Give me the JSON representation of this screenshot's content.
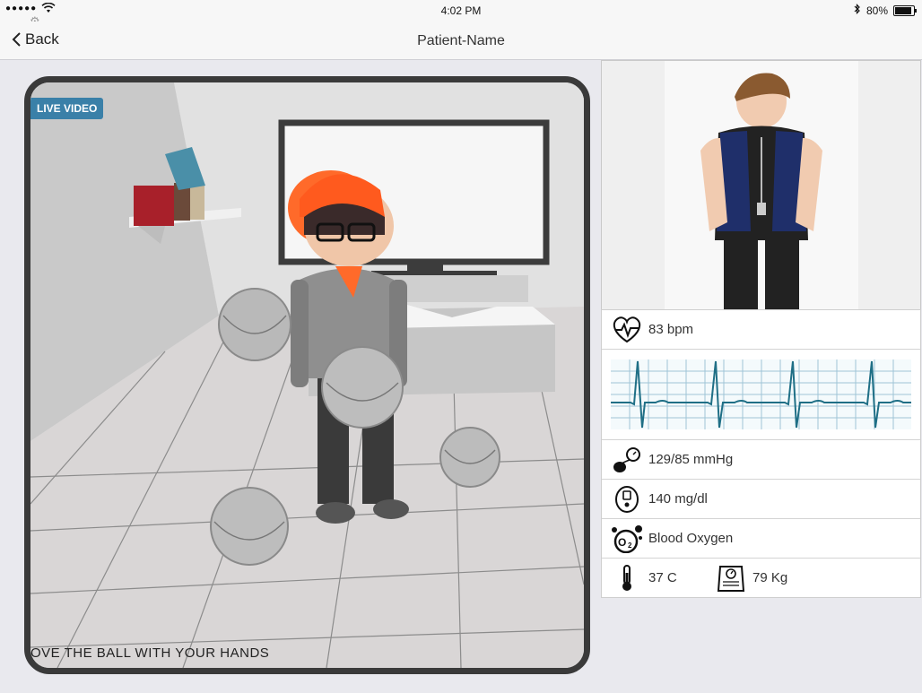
{
  "status": {
    "signal": "●●●●●",
    "time": "4:02 PM",
    "battery": "80%"
  },
  "nav": {
    "back_label": "Back",
    "title": "Patient-Name"
  },
  "video": {
    "badge": "LIVE VIDEO",
    "instruction": "OVE THE BALL WITH YOUR HANDS"
  },
  "vitals": {
    "heart_rate": "83 bpm",
    "blood_pressure": "129/85 mmHg",
    "glucose": "140 mg/dl",
    "oxygen": "Blood Oxygen",
    "temperature": "37 C",
    "weight": "79 Kg"
  },
  "icons": {
    "heart": "heart-pulse-icon",
    "bp": "blood-pressure-icon",
    "glucose": "glucose-meter-icon",
    "oxygen": "oxygen-icon",
    "temperature": "thermometer-icon",
    "weight": "scale-icon"
  },
  "colors": {
    "accent": "#3a80a8",
    "ecg_line": "#1f6f86",
    "grid": "#9fc4d6"
  }
}
